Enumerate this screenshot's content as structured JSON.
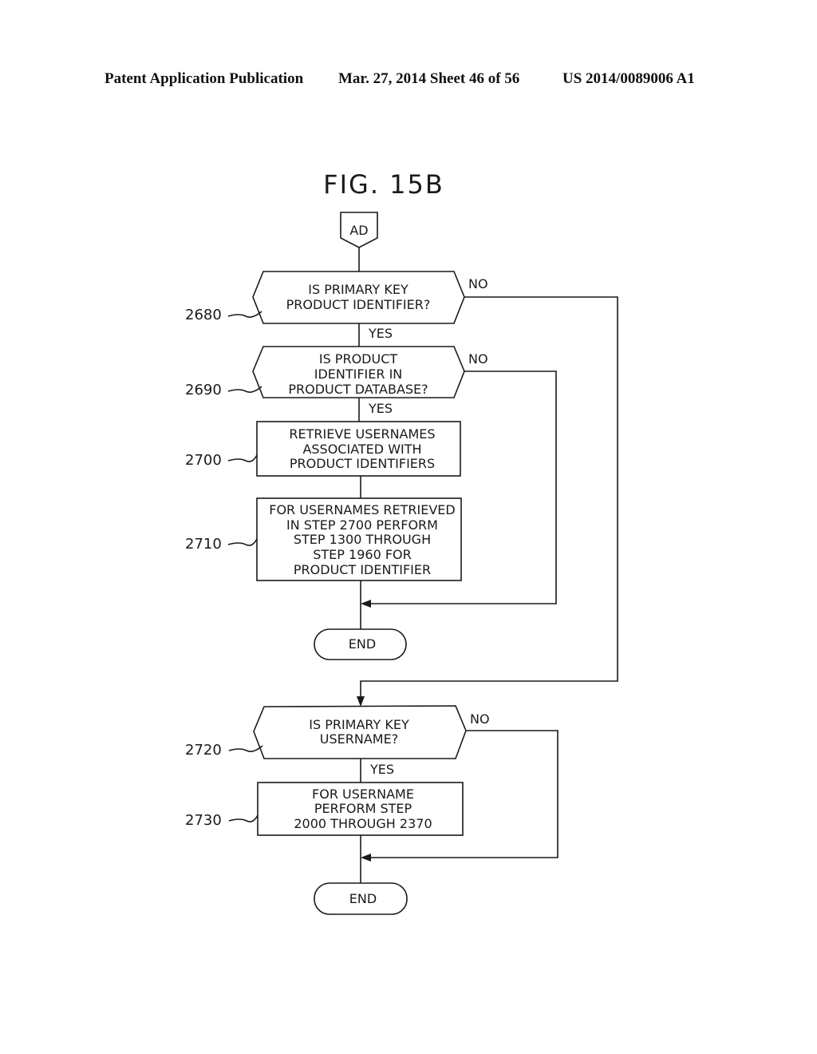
{
  "header": {
    "publication": "Patent Application Publication",
    "date_sheet": "Mar. 27, 2014  Sheet 46 of 56",
    "number": "US 2014/0089006 A1"
  },
  "figure": {
    "title": "FIG. 15B",
    "connector": "AD",
    "steps": [
      {
        "ref": "2680",
        "type": "decision",
        "lines": [
          "IS PRIMARY KEY",
          "PRODUCT IDENTIFIER?"
        ],
        "yes": "YES",
        "no": "NO"
      },
      {
        "ref": "2690",
        "type": "decision",
        "lines": [
          "IS PRODUCT",
          "IDENTIFIER IN",
          "PRODUCT DATABASE?"
        ],
        "yes": "YES",
        "no": "NO"
      },
      {
        "ref": "2700",
        "type": "process",
        "lines": [
          "RETRIEVE USERNAMES",
          "ASSOCIATED WITH",
          "PRODUCT IDENTIFIERS"
        ]
      },
      {
        "ref": "2710",
        "type": "process",
        "lines": [
          "FOR USERNAMES RETRIEVED",
          "IN STEP 2700 PERFORM",
          "STEP 1300 THROUGH",
          "STEP 1960 FOR",
          "PRODUCT IDENTIFIER"
        ]
      },
      {
        "ref": "",
        "type": "terminal",
        "lines": [
          "END"
        ]
      },
      {
        "ref": "2720",
        "type": "decision",
        "lines": [
          "IS PRIMARY KEY",
          "USERNAME?"
        ],
        "yes": "YES",
        "no": "NO"
      },
      {
        "ref": "2730",
        "type": "process",
        "lines": [
          "FOR USERNAME",
          "PERFORM STEP",
          "2000 THROUGH 2370"
        ]
      },
      {
        "ref": "",
        "type": "terminal",
        "lines": [
          "END"
        ]
      }
    ]
  }
}
